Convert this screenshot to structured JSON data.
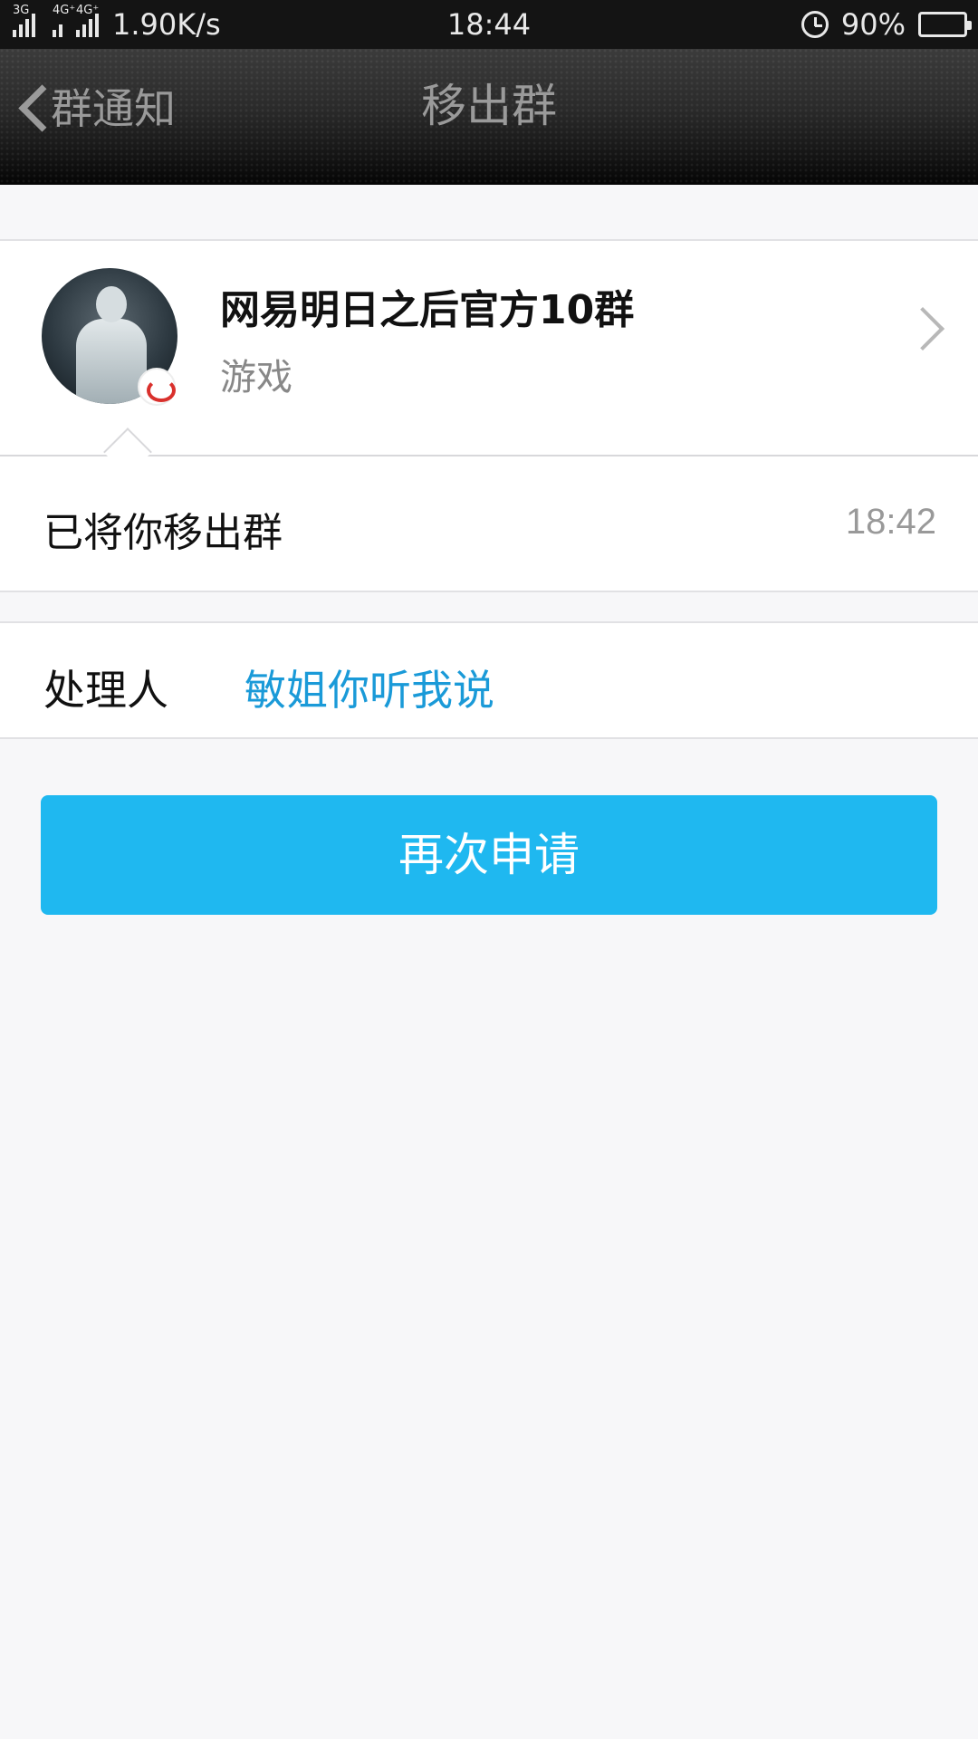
{
  "status_bar": {
    "net1": "3G",
    "net2": "4G⁺",
    "net3": "4G⁺",
    "speed": "1.90K/s",
    "time": "18:44",
    "battery": "90%",
    "battery_level": 0.9
  },
  "header": {
    "back_label": "群通知",
    "title": "移出群"
  },
  "group": {
    "name": "网易明日之后官方10群",
    "category": "游戏"
  },
  "notice": {
    "message": "已将你移出群",
    "time": "18:42"
  },
  "handler": {
    "label": "处理人",
    "name": "敏姐你听我说"
  },
  "actions": {
    "reapply_label": "再次申请"
  },
  "colors": {
    "accent": "#1fb8f0",
    "link": "#1a9ad8"
  }
}
